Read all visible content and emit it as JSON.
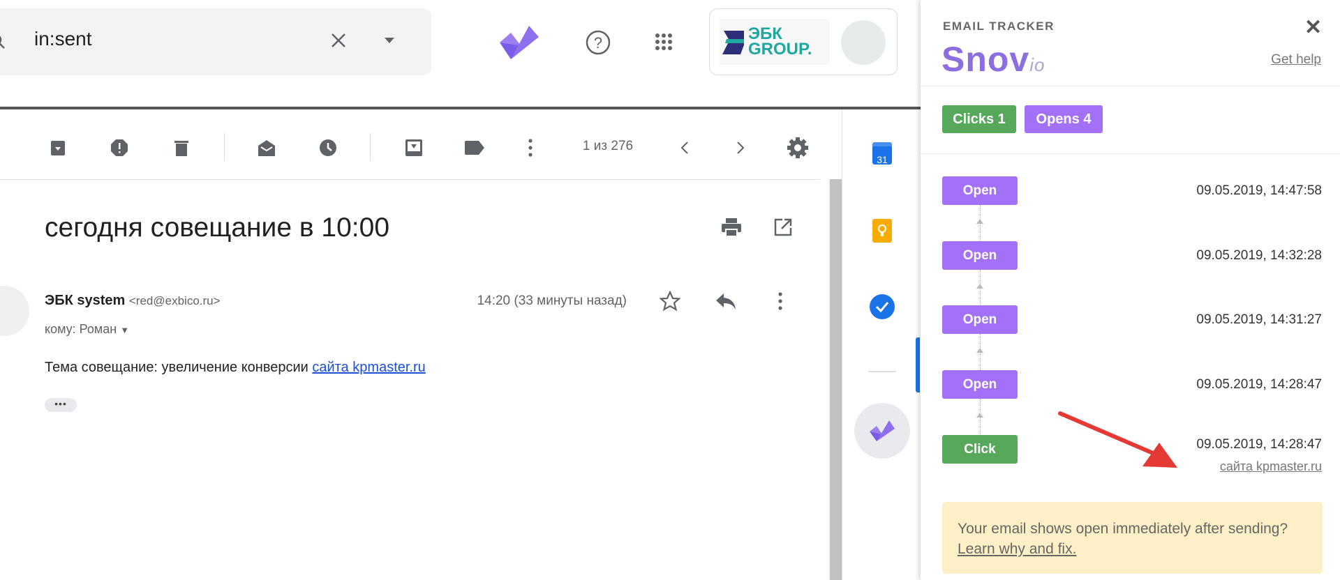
{
  "search": {
    "query": "in:sent",
    "icon": "search-icon"
  },
  "header": {
    "account_logo_text": "ЭБК GROUP."
  },
  "toolbar": {
    "pagination": "1 из 276"
  },
  "email": {
    "subject": "сегодня совещание в 10:00",
    "sender_name": "ЭБК system",
    "sender_email": "<red@exbico.ru>",
    "time": "14:20 (33 минуты назад)",
    "to": "кому: Роман",
    "body_text": "Тема совещание: увеличение конверсии ",
    "body_link": "сайта kpmaster.ru",
    "trimmed": "•••"
  },
  "side_panel": {
    "calendar_day": "31"
  },
  "tracker": {
    "title": "EMAIL TRACKER",
    "logo": "Snov",
    "logo_suffix": "io",
    "close": "✕",
    "get_help": "Get help",
    "clicks_badge": "Clicks 1",
    "opens_badge": "Opens 4",
    "events": [
      {
        "type": "Open",
        "timestamp": "09.05.2019, 14:47:58"
      },
      {
        "type": "Open",
        "timestamp": "09.05.2019, 14:32:28"
      },
      {
        "type": "Open",
        "timestamp": "09.05.2019, 14:31:27"
      },
      {
        "type": "Open",
        "timestamp": "09.05.2019, 14:28:47"
      },
      {
        "type": "Click",
        "timestamp": "09.05.2019, 14:28:47",
        "link": "сайта kpmaster.ru"
      }
    ],
    "note_text": "Your email shows open immediately after sending? ",
    "note_link": "Learn why and fix.",
    "colors": {
      "open": "#a371f7",
      "click": "#58a85c",
      "note_bg": "#fdf0c6",
      "arrow": "#e53935"
    }
  }
}
